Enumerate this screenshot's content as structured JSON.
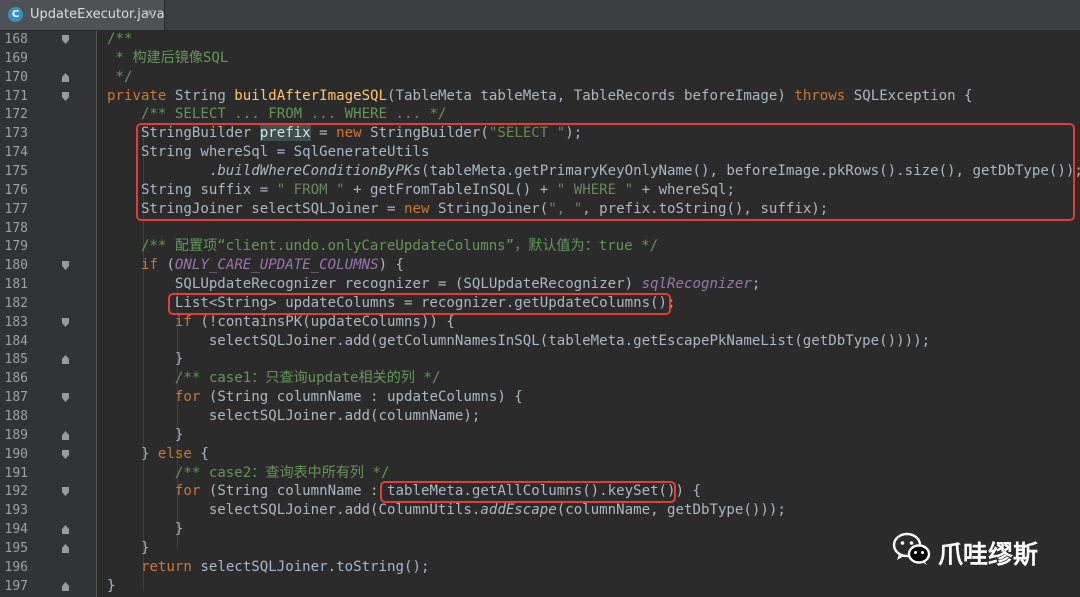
{
  "tab": {
    "icon_letter": "C",
    "title": "UpdateExecutor.java",
    "close": "×"
  },
  "lines": [
    {
      "num": "168",
      "fold": "down",
      "segments": [
        {
          "t": "/**",
          "c": "cm"
        }
      ]
    },
    {
      "num": "169",
      "fold": "",
      "segments": [
        {
          "t": " * 构建后镜像SQL",
          "c": "cm"
        }
      ]
    },
    {
      "num": "170",
      "fold": "up",
      "segments": [
        {
          "t": " */",
          "c": "cm"
        }
      ]
    },
    {
      "num": "171",
      "fold": "down",
      "segments": [
        {
          "t": "private ",
          "c": "kw"
        },
        {
          "t": "String ",
          "c": ""
        },
        {
          "t": "buildAfterImageSQL",
          "c": "mth"
        },
        {
          "t": "(TableMeta tableMeta, TableRecords beforeImage) ",
          "c": ""
        },
        {
          "t": "throws ",
          "c": "kw"
        },
        {
          "t": "SQLException {",
          "c": ""
        }
      ]
    },
    {
      "num": "172",
      "fold": "",
      "segments": [
        {
          "t": "    ",
          "c": ""
        },
        {
          "t": "/** SELECT ... FROM ... WHERE ... */",
          "c": "cm"
        }
      ]
    },
    {
      "num": "173",
      "fold": "",
      "segments": [
        {
          "t": "    StringBuilder ",
          "c": ""
        },
        {
          "t": "prefix",
          "c": "match"
        },
        {
          "t": " = ",
          "c": ""
        },
        {
          "t": "new ",
          "c": "kw"
        },
        {
          "t": "StringBuilder(",
          "c": ""
        },
        {
          "t": "\"SELECT \"",
          "c": "str"
        },
        {
          "t": ");",
          "c": ""
        }
      ]
    },
    {
      "num": "174",
      "fold": "",
      "segments": [
        {
          "t": "    String whereSql = SqlGenerateUtils",
          "c": ""
        }
      ]
    },
    {
      "num": "175",
      "fold": "",
      "segments": [
        {
          "t": "            .",
          "c": ""
        },
        {
          "t": "buildWhereConditionByPKs",
          "c": "ital"
        },
        {
          "t": "(tableMeta.getPrimaryKeyOnlyName(), beforeImage.pkRows().size(), getDbType());",
          "c": ""
        }
      ]
    },
    {
      "num": "176",
      "fold": "",
      "segments": [
        {
          "t": "    String suffix = ",
          "c": ""
        },
        {
          "t": "\" FROM \"",
          "c": "str"
        },
        {
          "t": " + getFromTableInSQL() + ",
          "c": ""
        },
        {
          "t": "\" WHERE \"",
          "c": "str"
        },
        {
          "t": " + whereSql;",
          "c": ""
        }
      ]
    },
    {
      "num": "177",
      "fold": "",
      "segments": [
        {
          "t": "    StringJoiner selectSQLJoiner = ",
          "c": ""
        },
        {
          "t": "new ",
          "c": "kw"
        },
        {
          "t": "StringJoiner(",
          "c": ""
        },
        {
          "t": "\", \"",
          "c": "str"
        },
        {
          "t": ", prefix.toString(), suffix);",
          "c": ""
        }
      ]
    },
    {
      "num": "178",
      "fold": "",
      "segments": [
        {
          "t": "",
          "c": ""
        }
      ]
    },
    {
      "num": "179",
      "fold": "",
      "segments": [
        {
          "t": "    ",
          "c": ""
        },
        {
          "t": "/** 配置项“client.undo.onlyCareUpdateColumns”，默认值为：true */",
          "c": "cm"
        }
      ]
    },
    {
      "num": "180",
      "fold": "down",
      "segments": [
        {
          "t": "    ",
          "c": ""
        },
        {
          "t": "if ",
          "c": "kw"
        },
        {
          "t": "(",
          "c": ""
        },
        {
          "t": "ONLY_CARE_UPDATE_COLUMNS",
          "c": "fld"
        },
        {
          "t": ") {",
          "c": ""
        }
      ]
    },
    {
      "num": "181",
      "fold": "",
      "segments": [
        {
          "t": "        SQLUpdateRecognizer recognizer = (SQLUpdateRecognizer) ",
          "c": ""
        },
        {
          "t": "sqlRecognizer",
          "c": "fld"
        },
        {
          "t": ";",
          "c": ""
        }
      ]
    },
    {
      "num": "182",
      "fold": "",
      "segments": [
        {
          "t": "        List<String> updateColumns = recognizer.getUpdateColumns();",
          "c": ""
        }
      ]
    },
    {
      "num": "183",
      "fold": "down",
      "segments": [
        {
          "t": "        ",
          "c": ""
        },
        {
          "t": "if ",
          "c": "kw"
        },
        {
          "t": "(!containsPK(updateColumns)) {",
          "c": ""
        }
      ]
    },
    {
      "num": "184",
      "fold": "",
      "segments": [
        {
          "t": "            selectSQLJoiner.add(getColumnNamesInSQL(tableMeta.getEscapePkNameList(getDbType())));",
          "c": ""
        }
      ]
    },
    {
      "num": "185",
      "fold": "up",
      "segments": [
        {
          "t": "        }",
          "c": ""
        }
      ]
    },
    {
      "num": "186",
      "fold": "",
      "segments": [
        {
          "t": "        ",
          "c": ""
        },
        {
          "t": "/** case1：只查询update相关的列 */",
          "c": "cm"
        }
      ]
    },
    {
      "num": "187",
      "fold": "down",
      "segments": [
        {
          "t": "        ",
          "c": ""
        },
        {
          "t": "for ",
          "c": "kw"
        },
        {
          "t": "(String columnName : updateColumns) {",
          "c": ""
        }
      ]
    },
    {
      "num": "188",
      "fold": "",
      "segments": [
        {
          "t": "            selectSQLJoiner.add(columnName);",
          "c": ""
        }
      ]
    },
    {
      "num": "189",
      "fold": "up",
      "segments": [
        {
          "t": "        }",
          "c": ""
        }
      ]
    },
    {
      "num": "190",
      "fold": "down",
      "segments": [
        {
          "t": "    } ",
          "c": ""
        },
        {
          "t": "else ",
          "c": "kw"
        },
        {
          "t": "{",
          "c": ""
        }
      ]
    },
    {
      "num": "191",
      "fold": "",
      "segments": [
        {
          "t": "        ",
          "c": ""
        },
        {
          "t": "/** case2：查询表中所有列 */",
          "c": "cm"
        }
      ]
    },
    {
      "num": "192",
      "fold": "down",
      "segments": [
        {
          "t": "        ",
          "c": ""
        },
        {
          "t": "for ",
          "c": "kw"
        },
        {
          "t": "(String columnName : tableMeta.getAllColumns().keySet()) {",
          "c": ""
        }
      ]
    },
    {
      "num": "193",
      "fold": "",
      "segments": [
        {
          "t": "            selectSQLJoiner.add(ColumnUtils.",
          "c": ""
        },
        {
          "t": "addEscape",
          "c": "ital"
        },
        {
          "t": "(columnName, getDbType()));",
          "c": ""
        }
      ]
    },
    {
      "num": "194",
      "fold": "up",
      "segments": [
        {
          "t": "        }",
          "c": ""
        }
      ]
    },
    {
      "num": "195",
      "fold": "up",
      "segments": [
        {
          "t": "    }",
          "c": ""
        }
      ]
    },
    {
      "num": "196",
      "fold": "",
      "segments": [
        {
          "t": "    ",
          "c": ""
        },
        {
          "t": "return ",
          "c": "kw"
        },
        {
          "t": "selectSQLJoiner.toString();",
          "c": ""
        }
      ]
    },
    {
      "num": "197",
      "fold": "up",
      "segments": [
        {
          "t": "}",
          "c": ""
        }
      ]
    }
  ],
  "highlight_color": "#e53e2e",
  "watermark": {
    "icon": "wechat-icon",
    "text": "爪哇缪斯"
  }
}
